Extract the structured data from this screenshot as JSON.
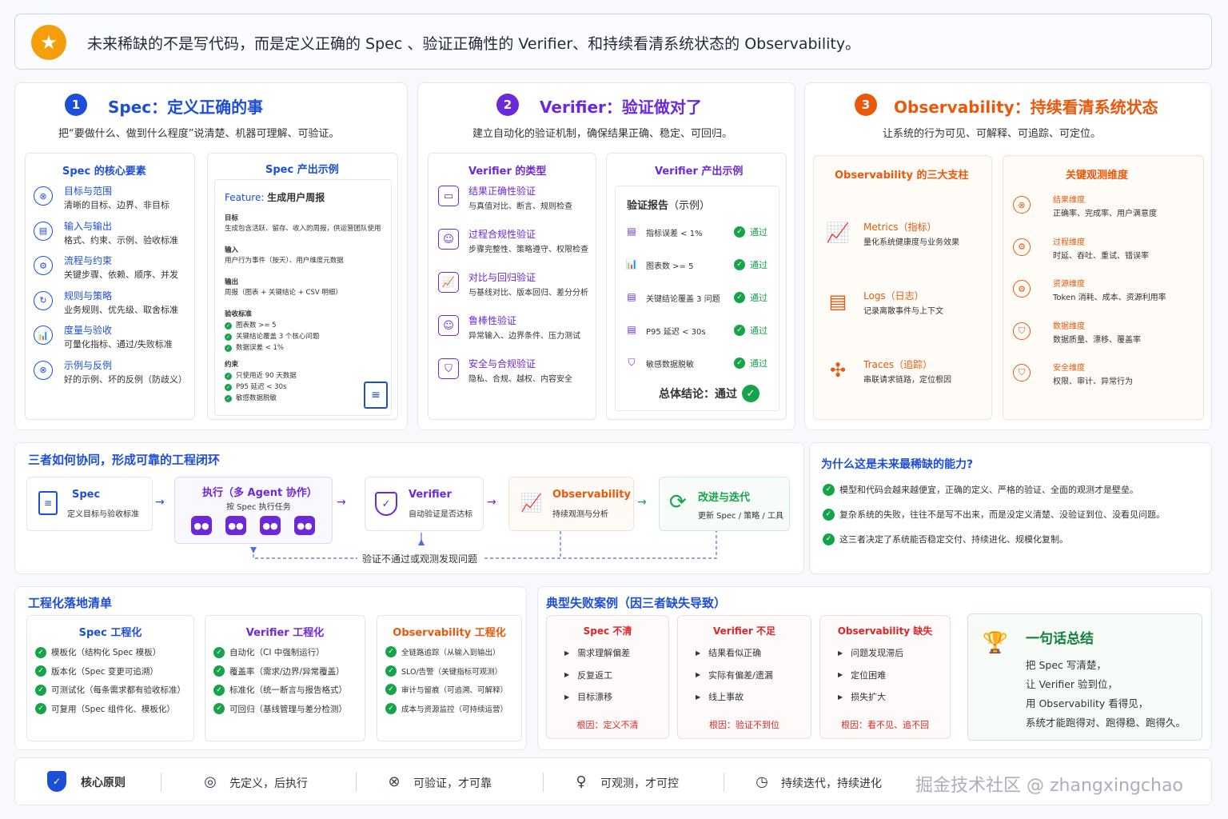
{
  "banner": {
    "text": "未来稀缺的不是写代码，而是定义正确的 Spec 、验证正确性的 Verifier、和持续看清系统状态的 Observability。"
  },
  "spec": {
    "num": "1",
    "title": "Spec：定义正确的事",
    "subtitle": "把“要做什么、做到什么程度”说清楚、机器可理解、可验证。",
    "core_title": "Spec 的核心要素",
    "core": [
      {
        "t": "目标与范围",
        "d": "清晰的目标、边界、非目标"
      },
      {
        "t": "输入与输出",
        "d": "格式、约束、示例、验收标准"
      },
      {
        "t": "流程与约束",
        "d": "关键步骤、依赖、顺序、并发"
      },
      {
        "t": "规则与策略",
        "d": "业务规则、优先级、取舍标准"
      },
      {
        "t": "度量与验收",
        "d": "可量化指标、通过/失败标准"
      },
      {
        "t": "示例与反例",
        "d": "好的示例、坏的反例（防歧义）"
      }
    ],
    "example_title": "Spec 产出示例",
    "feature_label": "Feature:",
    "feature_name": "生成用户周报",
    "goal_h": "目标",
    "goal": "生成包含活跃、留存、收入的周报，供运营团队使用",
    "input_h": "输入",
    "input": "用户行为事件（按天）、用户维度元数据",
    "output_h": "输出",
    "output": "周报（图表 + 关键结论 + CSV 明细）",
    "accept_h": "验收标准",
    "accept": [
      "图表数 >= 5",
      "关键结论覆盖 3 个核心问题",
      "数据误差 < 1%"
    ],
    "constraint_h": "约束",
    "constraint": [
      "只使用近 90 天数据",
      "P95 延迟 < 30s",
      "敏感数据脱敏"
    ]
  },
  "verifier": {
    "num": "2",
    "title": "Verifier：验证做对了",
    "subtitle": "建立自动化的验证机制，确保结果正确、稳定、可回归。",
    "types_title": "Verifier 的类型",
    "types": [
      {
        "t": "结果正确性验证",
        "d": "与真值对比、断言、规则检查"
      },
      {
        "t": "过程合规性验证",
        "d": "步骤完整性、策略遵守、权限检查"
      },
      {
        "t": "对比与回归验证",
        "d": "与基线对比、版本回归、差分分析"
      },
      {
        "t": "鲁棒性验证",
        "d": "异常输入、边界条件、压力测试"
      },
      {
        "t": "安全与合规验证",
        "d": "隐私、合规、越权、内容安全"
      }
    ],
    "example_title": "Verifier 产出示例",
    "report_title": "验证报告",
    "report_sub": "（示例）",
    "checks": [
      {
        "t": "指标误差 < 1%",
        "r": "通过"
      },
      {
        "t": "图表数 >= 5",
        "r": "通过"
      },
      {
        "t": "关键结论覆盖 3 问题",
        "r": "通过"
      },
      {
        "t": "P95 延迟 < 30s",
        "r": "通过"
      },
      {
        "t": "敏感数据脱敏",
        "r": "通过"
      }
    ],
    "conclusion_label": "总体结论：",
    "conclusion": "通过"
  },
  "obs": {
    "num": "3",
    "title": "Observability：持续看清系统状态",
    "subtitle": "让系统的行为可见、可解释、可追踪、可定位。",
    "pillars_title": "Observability 的三大支柱",
    "pillars": [
      {
        "t": "Metrics（指标）",
        "d": "量化系统健康度与业务效果"
      },
      {
        "t": "Logs（日志）",
        "d": "记录离散事件与上下文"
      },
      {
        "t": "Traces（追踪）",
        "d": "串联请求链路，定位根因"
      }
    ],
    "dims_title": "关键观测维度",
    "dims": [
      {
        "t": "结果维度",
        "d": "正确率、完成率、用户满意度"
      },
      {
        "t": "过程维度",
        "d": "时延、吞吐、重试、错误率"
      },
      {
        "t": "资源维度",
        "d": "Token 消耗、成本、资源利用率"
      },
      {
        "t": "数据维度",
        "d": "数据质量、漂移、覆盖率"
      },
      {
        "t": "安全维度",
        "d": "权限、审计、异常行为"
      }
    ]
  },
  "flow": {
    "title": "三者如何协同，形成可靠的工程闭环",
    "spec_t": "Spec",
    "spec_d": "定义目标与验收标准",
    "exec_t": "执行（多 Agent 协作）",
    "exec_d": "按 Spec 执行任务",
    "ver_t": "Verifier",
    "ver_d": "自动验证是否达标",
    "obs_t": "Observability",
    "obs_d": "持续观测与分析",
    "iter_t": "改进与迭代",
    "iter_d": "更新 Spec / 策略 / 工具",
    "loop": "验证不通过或观测发现问题"
  },
  "why": {
    "title": "为什么这是未来最稀缺的能力?",
    "items": [
      "模型和代码会越来越便宜，正确的定义、严格的验证、全面的观测才是壁垒。",
      "复杂系统的失败，往往不是写不出来，而是没定义清楚、没验证到位、没看见问题。",
      "这三者决定了系统能否稳定交付、持续进化、规模化复制。"
    ]
  },
  "checklist": {
    "title": "工程化落地清单",
    "cols": [
      {
        "t": "Spec 工程化",
        "items": [
          "模板化（结构化 Spec 模板）",
          "版本化（Spec 变更可追溯）",
          "可测试化（每条需求都有验收标准）",
          "可复用（Spec 组件化、模板化）"
        ]
      },
      {
        "t": "Verifier 工程化",
        "items": [
          "自动化（CI 中强制运行）",
          "覆盖率（需求/边界/异常覆盖）",
          "标准化（统一断言与报告格式）",
          "可回归（基线管理与差分检测）"
        ]
      },
      {
        "t": "Observability 工程化",
        "items": [
          "全链路追踪（从输入到输出）",
          "SLO/告警（关键指标可观测）",
          "审计与留痕（可追溯、可解释）",
          "成本与资源监控（可持续运营）"
        ]
      }
    ]
  },
  "failures": {
    "title": "典型失败案例（因三者缺失导致）",
    "cols": [
      {
        "t": "Spec 不清",
        "items": [
          "需求理解偏差",
          "反复返工",
          "目标漂移"
        ],
        "root": "根因：定义不清"
      },
      {
        "t": "Verifier 不足",
        "items": [
          "结果看似正确",
          "实际有偏差/遗漏",
          "线上事故"
        ],
        "root": "根因：验证不到位"
      },
      {
        "t": "Observability 缺失",
        "items": [
          "问题发现滞后",
          "定位困难",
          "损失扩大"
        ],
        "root": "根因：看不见、追不回"
      }
    ]
  },
  "summary": {
    "title": "一句话总结",
    "lines": [
      "把 Spec 写清楚，",
      "让 Verifier 验到位，",
      "用 Observability 看得见，",
      "系统才能跑得对、跑得稳、跑得久。"
    ]
  },
  "principles": {
    "title": "核心原则",
    "items": [
      "先定义，后执行",
      "可验证，才可靠",
      "可观测，才可控",
      "持续迭代，持续进化"
    ]
  },
  "watermark": "掘金技术社区 @ zhangxingchao",
  "colors": {
    "blue": "#1d4ed8",
    "purple": "#6d28d9",
    "orange": "#ea580c",
    "green": "#16a34a"
  }
}
